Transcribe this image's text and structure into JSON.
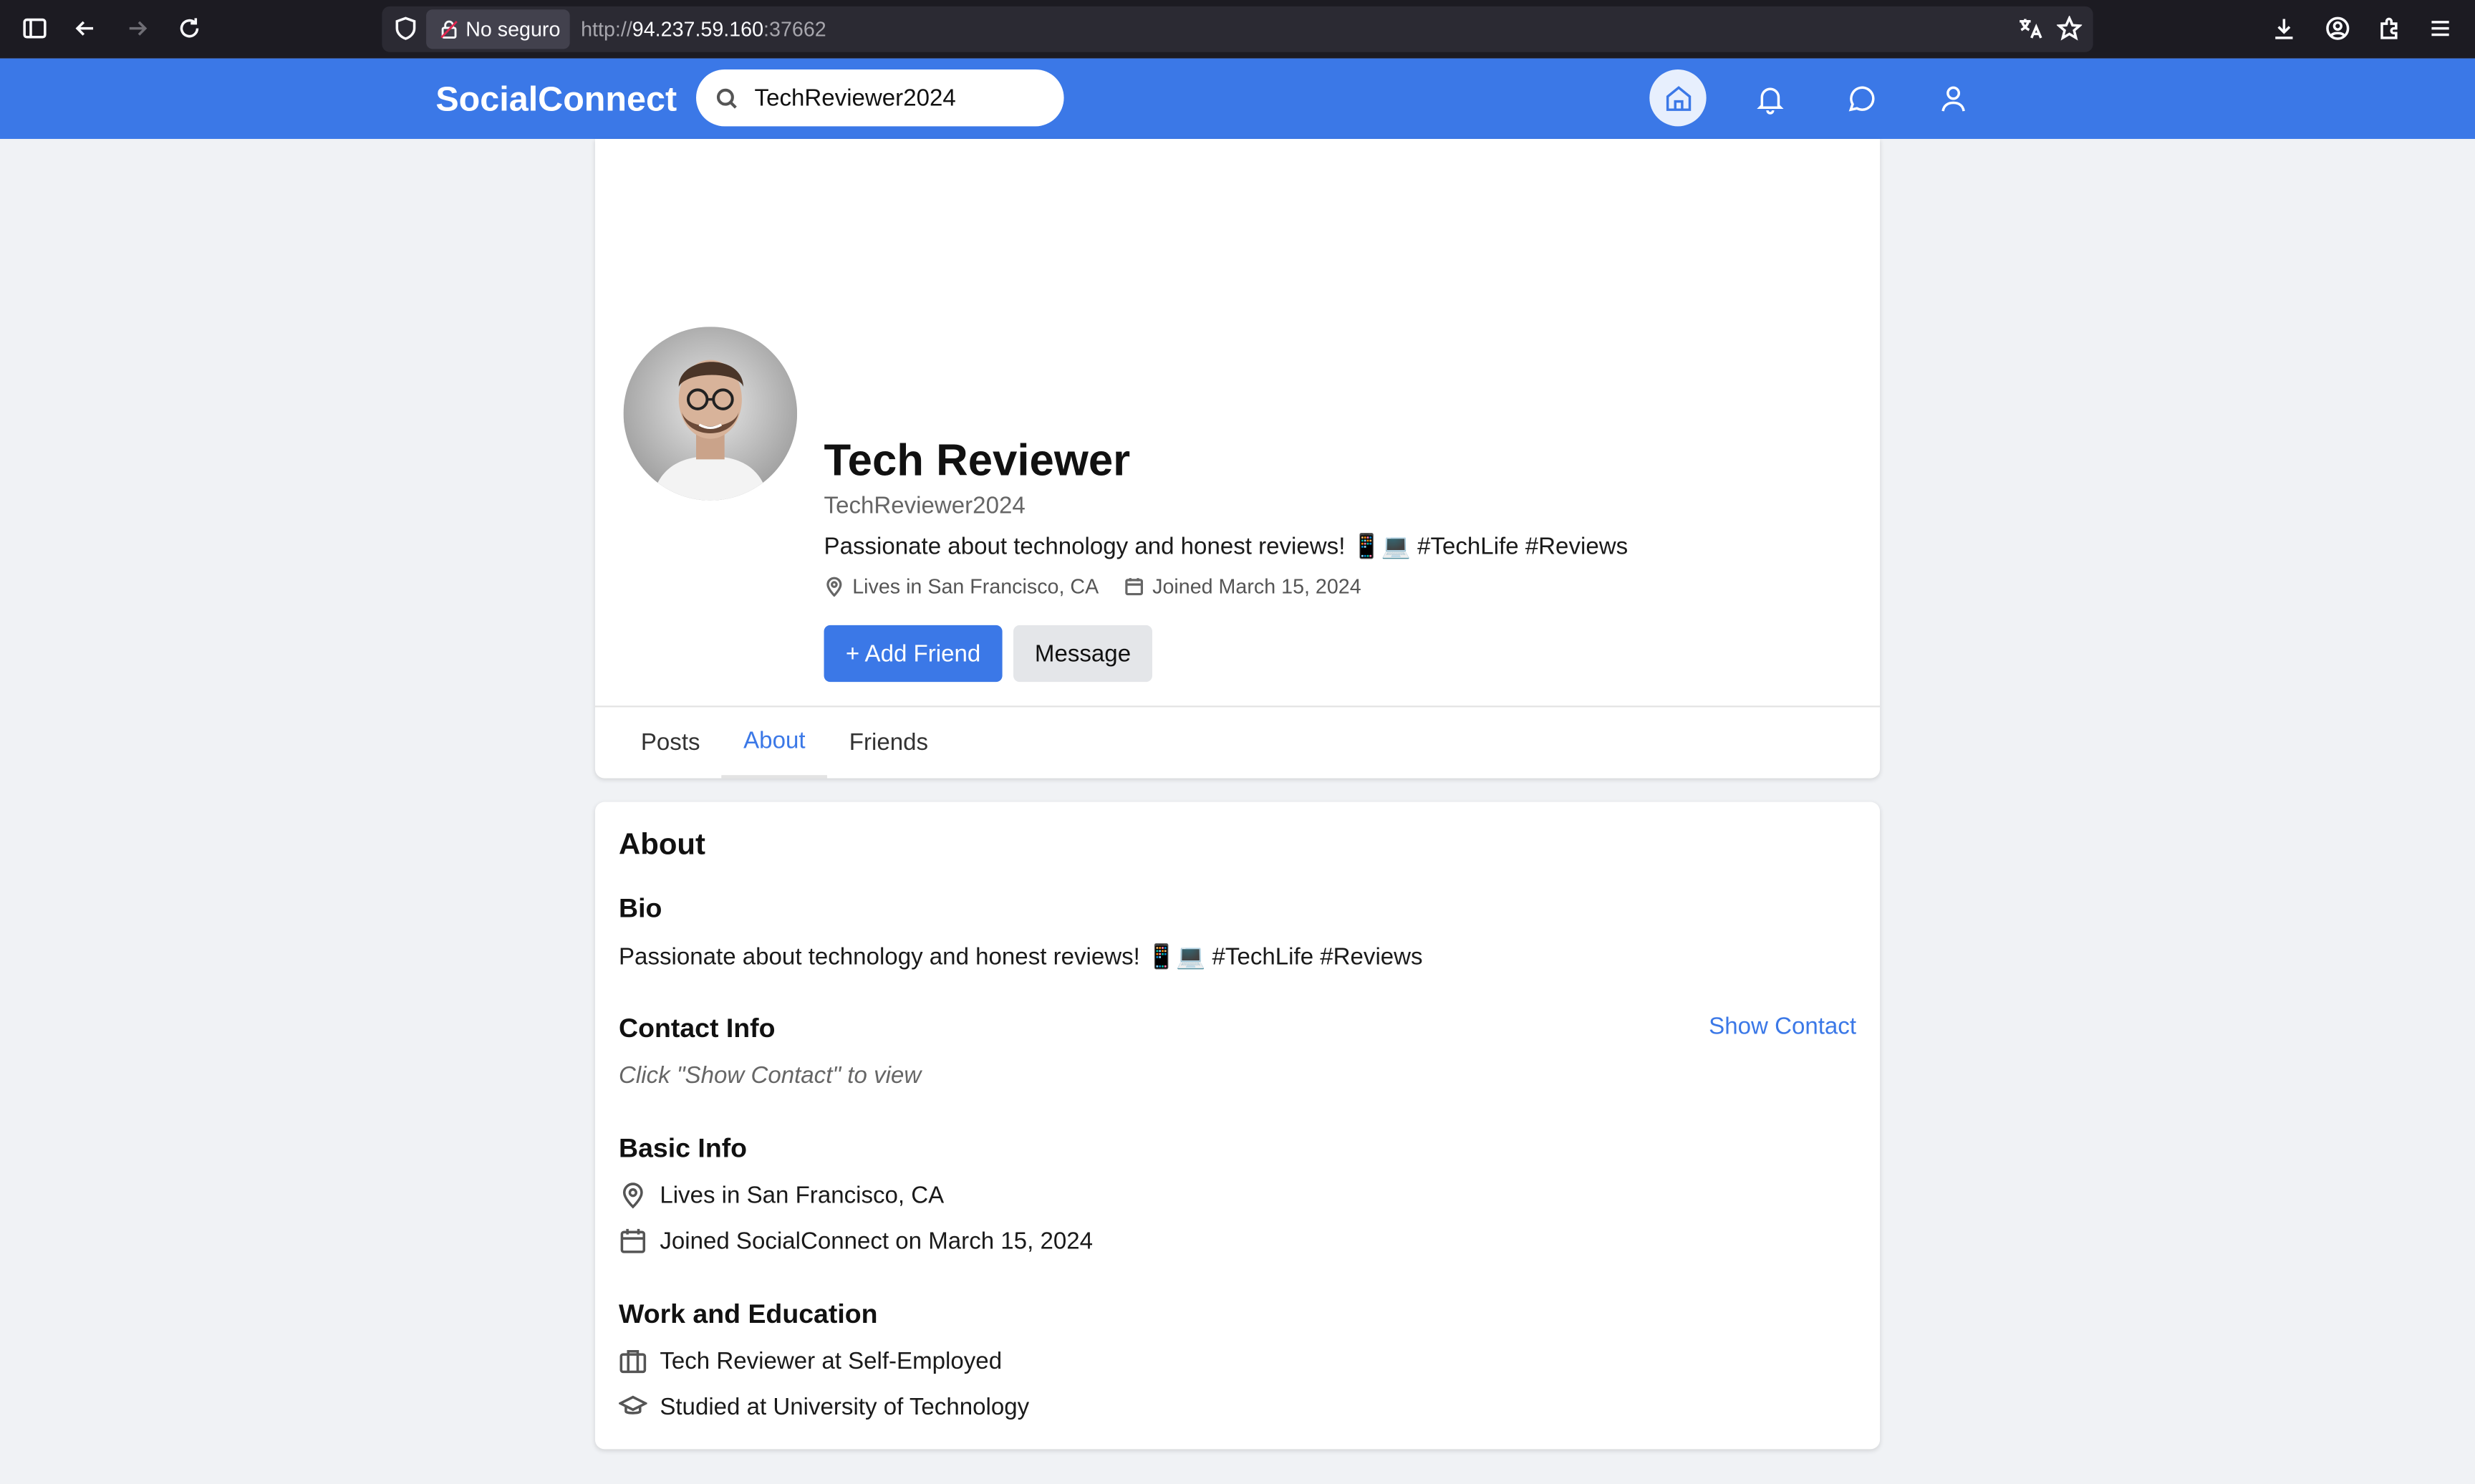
{
  "browser": {
    "security_label": "No seguro",
    "url_scheme": "http://",
    "url_host": "94.237.59.160",
    "url_port": ":37662"
  },
  "navbar": {
    "brand": "SocialConnect",
    "search_value": "TechReviewer2024"
  },
  "profile": {
    "name": "Tech Reviewer",
    "handle": "TechReviewer2024",
    "bio": "Passionate about technology and honest reviews! 📱💻 #TechLife #Reviews",
    "location": "Lives in San Francisco, CA",
    "joined": "Joined March 15, 2024",
    "add_friend_label": "+ Add Friend",
    "message_label": "Message"
  },
  "tabs": [
    {
      "label": "Posts"
    },
    {
      "label": "About"
    },
    {
      "label": "Friends"
    }
  ],
  "about": {
    "title": "About",
    "bio_heading": "Bio",
    "bio_text": "Passionate about technology and honest reviews! 📱💻 #TechLife #Reviews",
    "contact_heading": "Contact Info",
    "show_contact_label": "Show Contact",
    "contact_hint": "Click \"Show Contact\" to view",
    "basic_heading": "Basic Info",
    "basic_location": "Lives in San Francisco, CA",
    "basic_joined": "Joined SocialConnect on March 15, 2024",
    "work_heading": "Work and Education",
    "work": "Tech Reviewer at Self-Employed",
    "education": "Studied at University of Technology"
  },
  "colors": {
    "brand_blue": "#3b78e7",
    "page_bg": "#f0f2f5"
  }
}
